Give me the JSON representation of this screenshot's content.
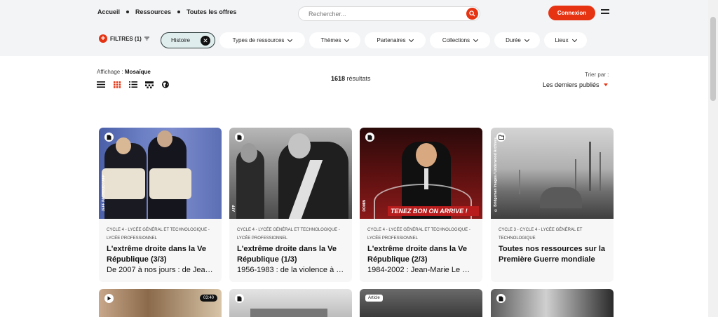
{
  "nav": {
    "links": [
      "Accueil",
      "Ressources",
      "Toutes les offres"
    ]
  },
  "search": {
    "placeholder": "Rechercher..."
  },
  "header": {
    "login_label": "Connexion"
  },
  "filters": {
    "label": "FILTRES (1)",
    "active_chip": "Histoire",
    "dropdowns": [
      "Types de ressources",
      "Thèmes",
      "Partenaires",
      "Collections",
      "Durée",
      "Lieux"
    ]
  },
  "toolbar": {
    "affichage_label": "Affichage :",
    "affichage_value": "Mosaïque",
    "results_count": "1618",
    "results_label": "résultats",
    "sort_label": "Trier par :",
    "sort_value": "Les derniers publiés"
  },
  "cards": [
    {
      "level": "CYCLE 4 - LYCÉE GÉNÉRAL ET TECHNOLOGIQUE - LYCÉE PROFESSIONNEL",
      "title": "L'extrême droite dans la Ve République (3/3)",
      "subtitle": "De 2007 à nos jours : de Jean-...",
      "credit": "JEFF PACHOUD / AFP",
      "icon": "document-icon"
    },
    {
      "level": "CYCLE 4 - LYCÉE GÉNÉRAL ET TECHNOLOGIQUE - LYCÉE PROFESSIONNEL",
      "title": "L'extrême droite dans la Ve République (1/3)",
      "subtitle": "1956-1983 : de la violence à la...",
      "credit": "AFP",
      "icon": "document-icon"
    },
    {
      "level": "CYCLE 4 - LYCÉE GÉNÉRAL ET TECHNOLOGIQUE - LYCÉE PROFESSIONNEL",
      "title": "L'extrême droite dans la Ve République (2/3)",
      "subtitle": "1984-2002 : Jean-Marie Le Pe...",
      "credit": "DOMIN",
      "icon": "document-icon"
    },
    {
      "level": "CYCLE 3 - CYCLE 4 - LYCÉE GÉNÉRAL ET TECHNOLOGIQUE",
      "title": "Toutes nos ressources sur la Première Guerre mondiale",
      "subtitle": "",
      "credit": "© Bridgeman Images / Underwood Archives",
      "icon": "folder-icon"
    }
  ],
  "cards_row2": [
    {
      "tag": "",
      "duration": "03:40",
      "icon": "play-icon"
    },
    {
      "tag": "",
      "duration": "",
      "icon": "document-icon"
    },
    {
      "tag": "Article",
      "duration": "",
      "icon": ""
    },
    {
      "tag": "",
      "duration": "",
      "icon": "document-icon"
    }
  ]
}
